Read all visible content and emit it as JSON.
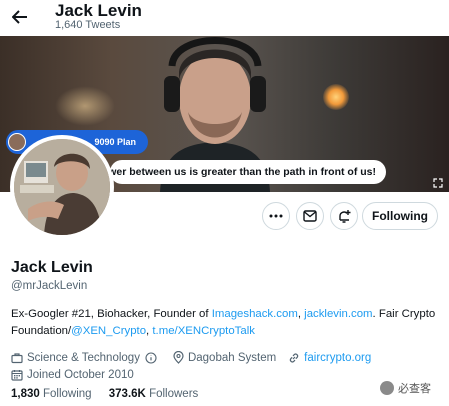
{
  "header": {
    "name": "Jack Levin",
    "tweet_count": "1,640 Tweets"
  },
  "banner": {
    "plan_label": "9090 Plan",
    "quote": "the Power between us is greater than the path in front of us!"
  },
  "actions": {
    "follow_label": "Following"
  },
  "profile": {
    "name": "Jack Levin",
    "handle": "@mrJackLevin",
    "bio": {
      "t1": "Ex-Googler #21, Biohacker, Founder of ",
      "link1": "Imageshack.com",
      "t2": ", ",
      "link2": "jacklevin.com",
      "t3": ". Fair Crypto Foundation/",
      "link3": "@XEN_Crypto",
      "t4": ", ",
      "link4": "t.me/XENCryptoTalk"
    },
    "category": "Science & Technology",
    "location": "Dagobah System",
    "website": "faircrypto.org",
    "joined": "Joined October 2010"
  },
  "stats": {
    "following_count": "1,830",
    "following_label": "Following",
    "followers_count": "373.6K",
    "followers_label": "Followers"
  },
  "watermark": {
    "text": "必查客"
  },
  "colors": {
    "link": "#1d9bf0",
    "text": "#0f1419",
    "muted": "#536471",
    "plan_blue": "#1d64d8"
  }
}
